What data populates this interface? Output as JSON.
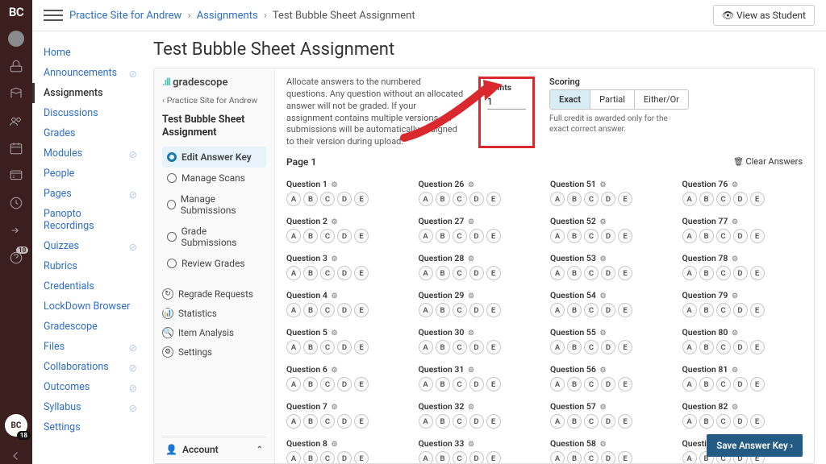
{
  "rail": {
    "logo": "BC",
    "notif_count": "10",
    "bottom_badge": "BC",
    "bottom_count": "18"
  },
  "topbar": {
    "crumb1": "Practice Site for Andrew",
    "crumb2": "Assignments",
    "crumb3": "Test Bubble Sheet Assignment",
    "view_as": "👁 View as Student"
  },
  "coursenav": {
    "items": [
      {
        "label": "Home"
      },
      {
        "label": "Announcements",
        "hidden": true
      },
      {
        "label": "Assignments",
        "active": true
      },
      {
        "label": "Discussions"
      },
      {
        "label": "Grades"
      },
      {
        "label": "Modules",
        "hidden": true
      },
      {
        "label": "People"
      },
      {
        "label": "Pages",
        "hidden": true
      },
      {
        "label": "Panopto Recordings"
      },
      {
        "label": "Quizzes",
        "hidden": true
      },
      {
        "label": "Rubrics"
      },
      {
        "label": "Credentials"
      },
      {
        "label": "LockDown Browser"
      },
      {
        "label": "Gradescope"
      },
      {
        "label": "Files",
        "hidden": true
      },
      {
        "label": "Collaborations",
        "hidden": true
      },
      {
        "label": "Outcomes",
        "hidden": true
      },
      {
        "label": "Syllabus",
        "hidden": true
      },
      {
        "label": "Settings"
      }
    ]
  },
  "page_title": "Test Bubble Sheet Assignment",
  "gs": {
    "brand": "gradescope",
    "back": "‹ Practice Site for Andrew",
    "assign_title": "Test Bubble Sheet Assignment",
    "steps": [
      "Edit Answer Key",
      "Manage Scans",
      "Manage Submissions",
      "Grade Submissions",
      "Review Grades"
    ],
    "active_step": 0,
    "tools": [
      "Regrade Requests",
      "Statistics",
      "Item Analysis",
      "Settings"
    ],
    "tool_icons": [
      "↻",
      "📊",
      "🔍",
      "⚙"
    ],
    "account": "Account"
  },
  "intro": "Allocate answers to the numbered questions. Any question without an allocated answer will not be graded. If your assignment contains multiple versions, all submissions will be automatically assigned to their version during upload.",
  "points": {
    "label": "Points",
    "value": "1"
  },
  "scoring": {
    "label": "Scoring",
    "options": [
      "Exact",
      "Partial",
      "Either/Or"
    ],
    "selected": 0,
    "help": "Full credit is awarded only for the exact correct answer."
  },
  "page_label": "Page 1",
  "clear": "Clear Answers",
  "bubble_opts": [
    "A",
    "B",
    "C",
    "D",
    "E"
  ],
  "columns": [
    {
      "start": 1,
      "count": 8
    },
    {
      "start": 26,
      "count": 8
    },
    {
      "start": 51,
      "count": 8
    },
    {
      "start": 76,
      "count": 8
    }
  ],
  "question_prefix": "Question ",
  "save": "Save Answer Key ›"
}
